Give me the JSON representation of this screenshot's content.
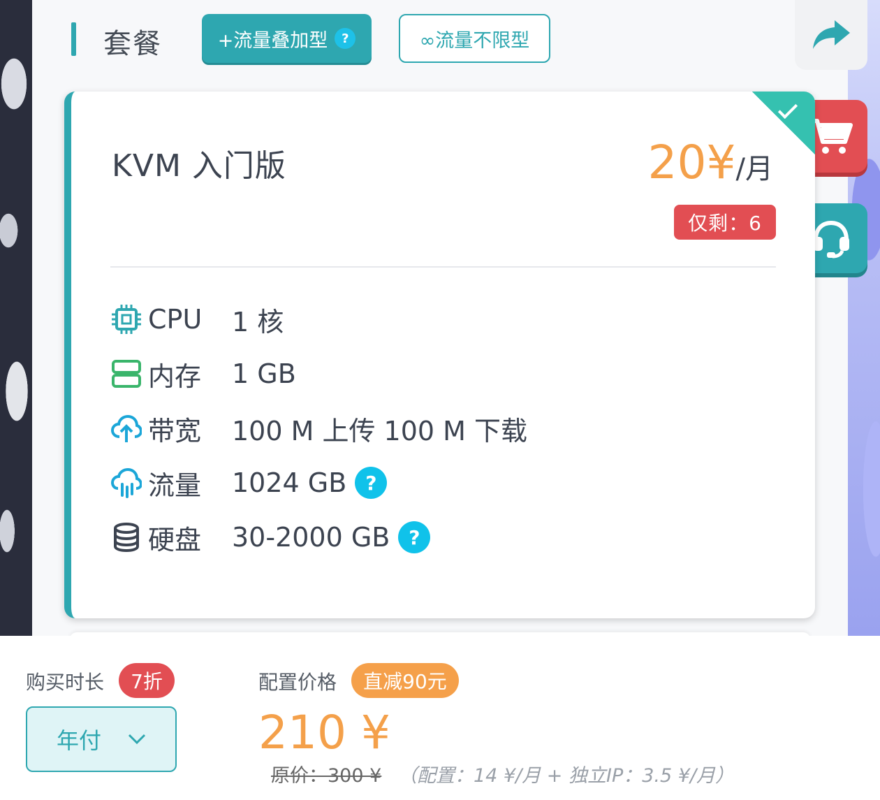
{
  "header": {
    "title": "套餐",
    "tabs": [
      {
        "label": "+流量叠加型",
        "help": "?",
        "active": true
      },
      {
        "label": "∞流量不限型",
        "active": false
      }
    ]
  },
  "card": {
    "name": "KVM 入门版",
    "price": {
      "amount": "20¥",
      "unit": "/月"
    },
    "stock": "仅剩：6",
    "specs": [
      {
        "icon": "cpu-icon",
        "label": "CPU",
        "value": "1 核"
      },
      {
        "icon": "memory-icon",
        "label": "内存",
        "value": "1 GB"
      },
      {
        "icon": "cloud-upload-icon",
        "label": "带宽",
        "value": "100 M 上传 100 M 下载"
      },
      {
        "icon": "cloud-rain-icon",
        "label": "流量",
        "value": "1024 GB",
        "help": "?"
      },
      {
        "icon": "database-icon",
        "label": "硬盘",
        "value": "30-2000 GB",
        "help": "?"
      }
    ]
  },
  "bottom": {
    "duration_label": "购买时长",
    "discount_badge": "7折",
    "duration_value": "年付",
    "config_label": "配置价格",
    "reduction_badge": "直减90元",
    "total_price": "210 ¥",
    "original_price": "原价：300 ¥",
    "price_note": "（配置：14 ¥/月 + 独立IP：3.5 ¥/月）"
  },
  "colors": {
    "accent": "#2ea7b0",
    "price": "#f4a04a",
    "danger": "#e24e53",
    "help": "#10c2ea"
  }
}
